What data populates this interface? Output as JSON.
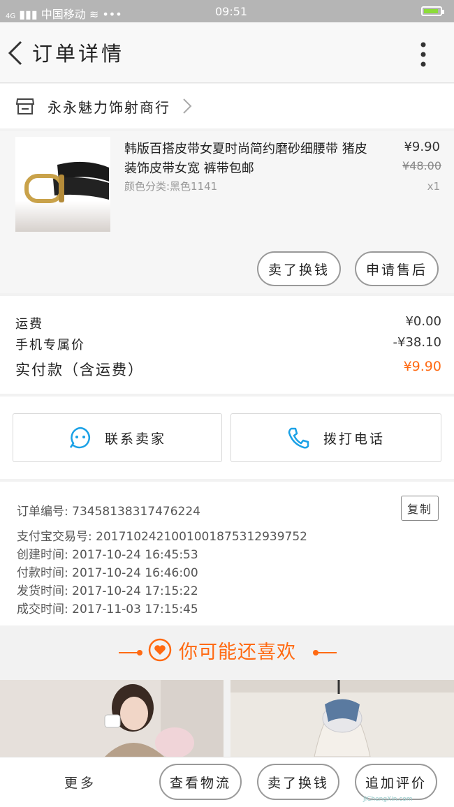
{
  "status_bar": {
    "carrier": "中国移动",
    "signal_badge": "4G",
    "extra": "•••",
    "time": "09:51"
  },
  "header": {
    "title": "订单详情"
  },
  "shop": {
    "name": "永永魅力饰射商行"
  },
  "product": {
    "title": "韩版百搭皮带女夏时尚简约磨砂细腰带 猪皮装饰皮带女宽 裤带包邮",
    "variant": "颜色分类:黑色1141",
    "price": "¥9.90",
    "original_price": "¥48.00",
    "quantity": "x1",
    "buttons": {
      "sell_label": "卖了换钱",
      "after_sale_label": "申请售后"
    }
  },
  "fees": {
    "shipping_label": "运费",
    "shipping_value": "¥0.00",
    "mobile_label": "手机专属价",
    "mobile_value": "-¥38.10",
    "total_label": "实付款（含运费）",
    "total_value": "¥9.90"
  },
  "contact": {
    "seller_label": "联系卖家",
    "call_label": "拨打电话"
  },
  "order_info": {
    "order_no": "订单编号: 73458138317476224",
    "alipay_no": "支付宝交易号: 2017102421001001875312939752",
    "created": "创建时间: 2017-10-24 16:45:53",
    "paid": "付款时间: 2017-10-24 16:46:00",
    "shipped": "发货时间: 2017-10-24 17:15:22",
    "completed": "成交时间: 2017-11-03 17:15:45",
    "copy_label": "复制"
  },
  "recommend": {
    "title": "你可能还喜欢"
  },
  "bottom_bar": {
    "more_label": "更多",
    "logistics_label": "查看物流",
    "sell_label": "卖了换钱",
    "review_label": "追加评价"
  },
  "watermark": {
    "text": "JiChengXin.com"
  },
  "colors": {
    "accent": "#ff6a13",
    "contact_icon": "#1aa1e6",
    "status_bar": "#b5b5b5"
  },
  "icons": {
    "back": "chevron-left-icon",
    "more": "more-vertical-icon",
    "shop": "store-icon",
    "contact_seller": "chat-bubble-icon",
    "call": "phone-icon",
    "recommend": "heart-icon"
  }
}
